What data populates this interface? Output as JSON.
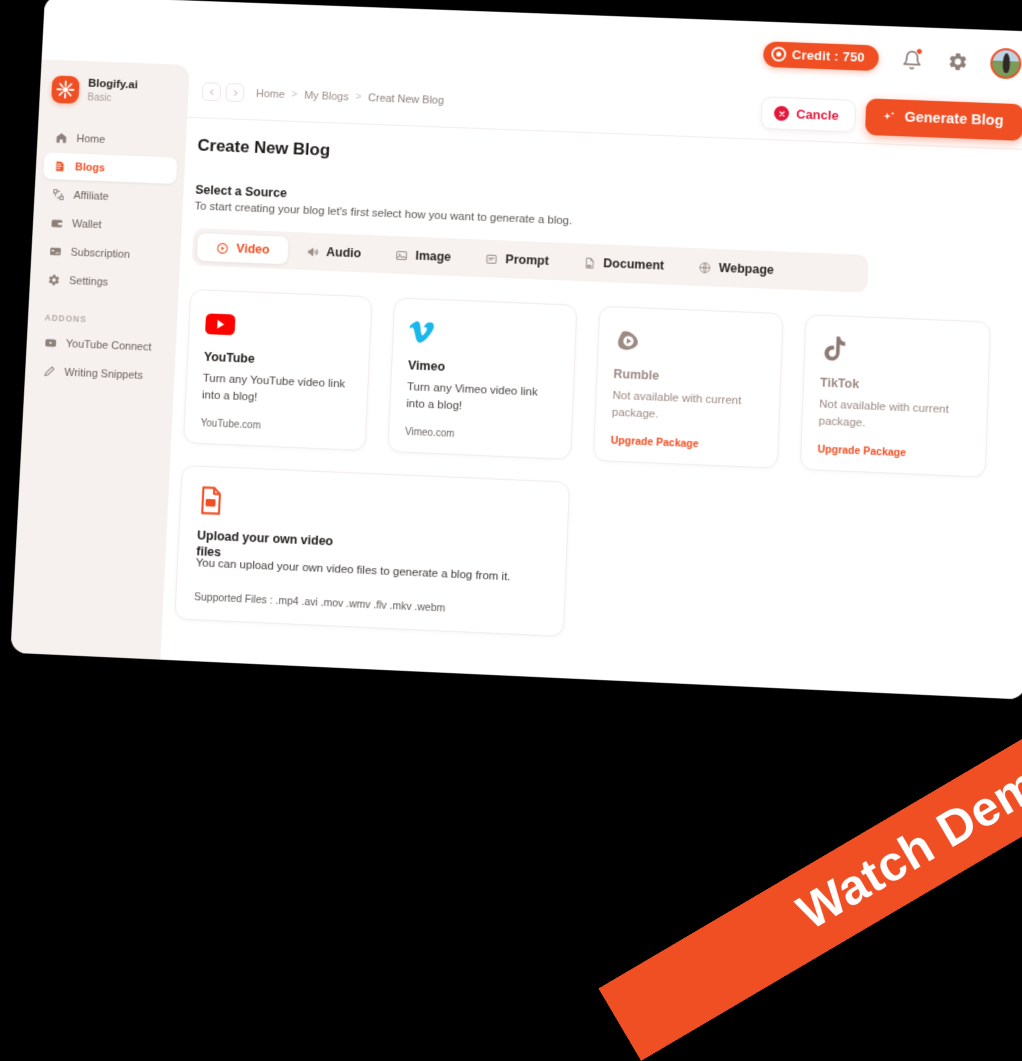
{
  "topbar": {
    "credit_label": "Credit : 750",
    "credit_color": "#f04e23",
    "bell_icon": "bell-icon",
    "gear_icon": "gear-icon",
    "avatar_icon": "avatar"
  },
  "sidebar": {
    "brand_name": "Blogify.ai",
    "brand_plan": "Basic",
    "items": [
      {
        "label": "Home",
        "icon": "home-icon",
        "active": false
      },
      {
        "label": "Blogs",
        "icon": "blogs-icon",
        "active": true
      },
      {
        "label": "Affiliate",
        "icon": "affiliate-icon",
        "active": false
      },
      {
        "label": "Wallet",
        "icon": "wallet-icon",
        "active": false
      },
      {
        "label": "Subscription",
        "icon": "subscription-icon",
        "active": false
      },
      {
        "label": "Settings",
        "icon": "gear-icon",
        "active": false
      }
    ],
    "addons_heading": "ADDONS",
    "addons": [
      {
        "label": "YouTube Connect",
        "icon": "youtube-connect-icon"
      },
      {
        "label": "Writing Snippets",
        "icon": "pen-icon"
      }
    ]
  },
  "breadcrumb": {
    "back_icon": "chevron-left-icon",
    "forward_icon": "chevron-right-icon",
    "items": [
      "Home",
      "My Blogs",
      "Creat New Blog"
    ],
    "separator": ">"
  },
  "actions": {
    "cancel_label": "Cancle",
    "cancel_color": "#e2173b",
    "generate_label": "Generate Blog",
    "generate_color": "#f04e23"
  },
  "main": {
    "page_title": "Create New Blog",
    "section_title": "Select a Source",
    "section_subtitle": "To start creating your blog let's first select how you want to generate a blog.",
    "tabs": [
      {
        "label": "Video",
        "icon": "play-circle-icon",
        "active": true
      },
      {
        "label": "Audio",
        "icon": "speaker-icon",
        "active": false
      },
      {
        "label": "Image",
        "icon": "image-icon",
        "active": false
      },
      {
        "label": "Prompt",
        "icon": "prompt-icon",
        "active": false
      },
      {
        "label": "Document",
        "icon": "pdf-file-icon",
        "active": false
      },
      {
        "label": "Webpage",
        "icon": "globe-icon",
        "active": false
      }
    ],
    "cards": [
      {
        "name": "YouTube",
        "icon": "youtube-icon",
        "description": "Turn any YouTube video link into a blog!",
        "footer": "YouTube.com",
        "disabled": false
      },
      {
        "name": "Vimeo",
        "icon": "vimeo-icon",
        "description": "Turn any Vimeo video link into a blog!",
        "footer": "Vimeo.com",
        "disabled": false
      },
      {
        "name": "Rumble",
        "icon": "rumble-icon",
        "description": "Not available with current package.",
        "footer": "Upgrade Package",
        "disabled": true
      },
      {
        "name": "TikTok",
        "icon": "tiktok-icon",
        "description": "Not available with current package.",
        "footer": "Upgrade Package",
        "disabled": true
      }
    ],
    "upload": {
      "icon": "upload-file-icon",
      "title": "Upload your own video files",
      "description": "You can upload your own video files to generate a blog from it.",
      "footer": "Supported Files : .mp4 .avi .mov .wmv .flv .mkv .webm"
    }
  },
  "ribbon": {
    "label": "Watch Demo",
    "color": "#f04e23"
  }
}
